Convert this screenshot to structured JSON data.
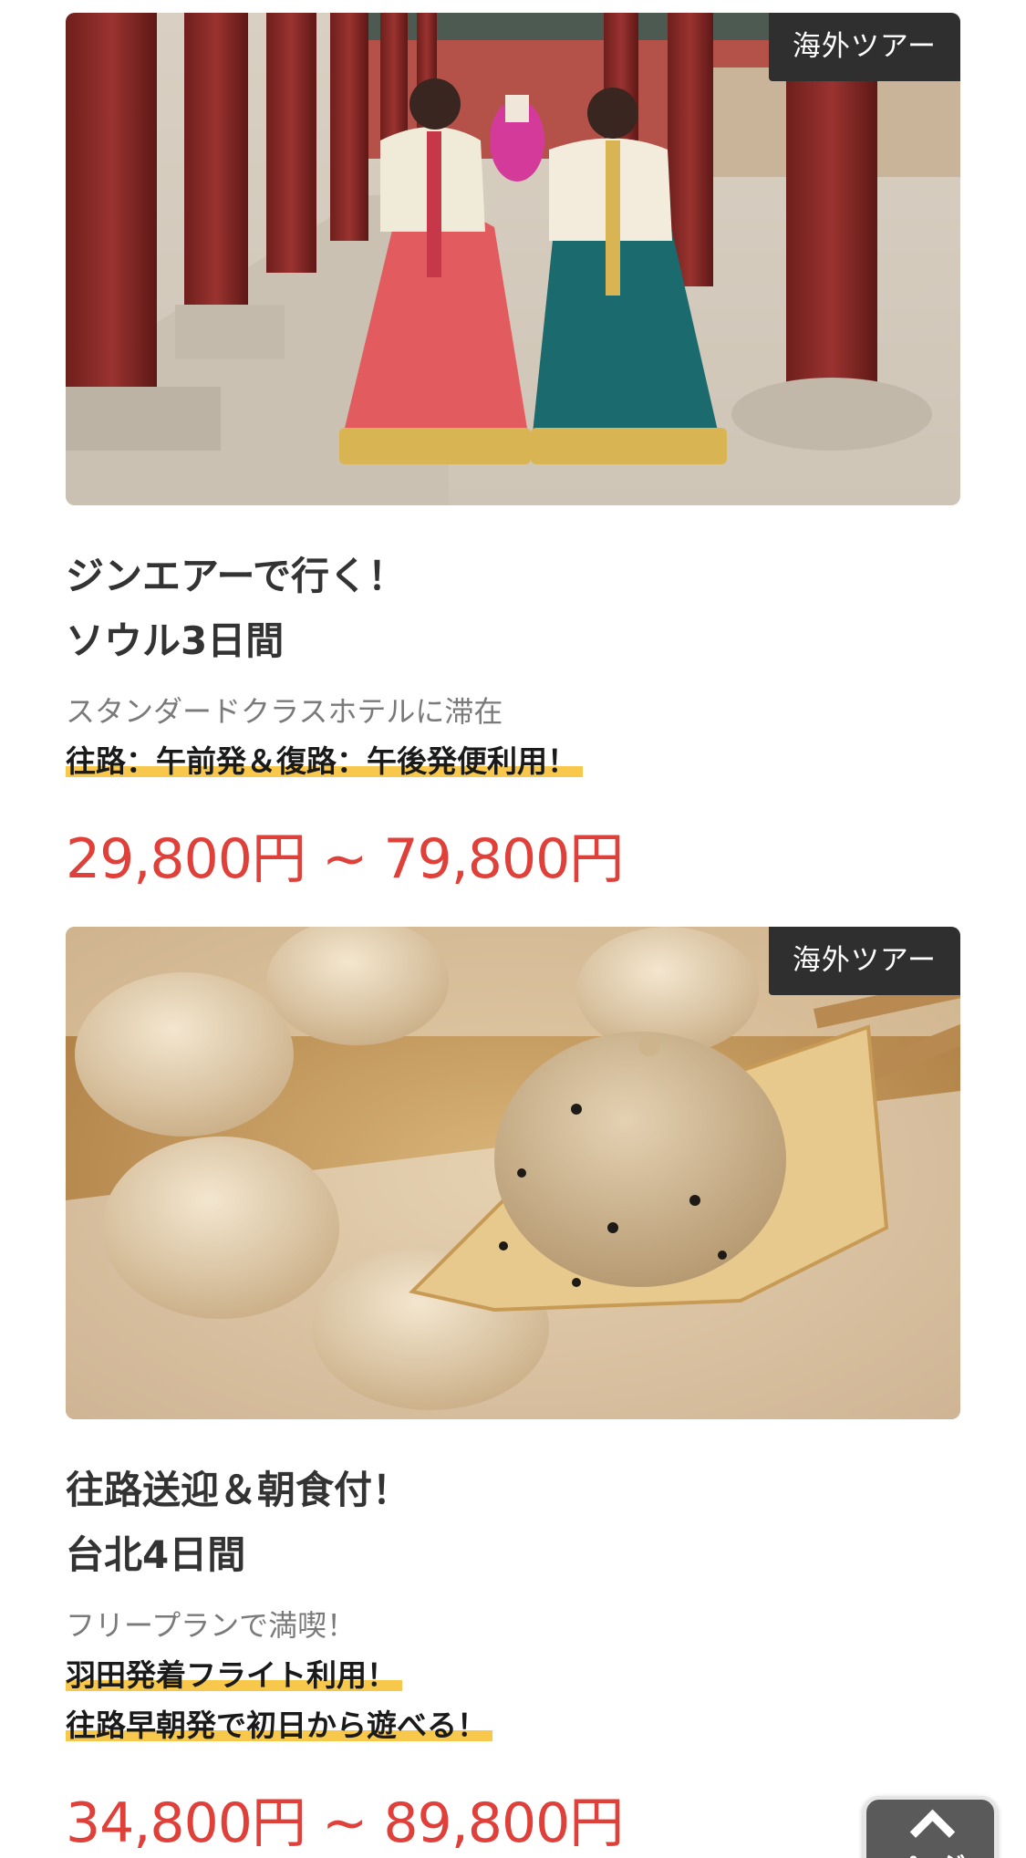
{
  "tours": [
    {
      "badge": "海外ツアー",
      "image": "seoul-hanbok-photo",
      "title_line1": "ジンエアーで行く！",
      "title_line2": "ソウル3日間",
      "subtitle": "スタンダードクラスホテルに滞在",
      "highlights": [
        "往路：午前発＆復路：午後発便利用！"
      ],
      "price": "29,800円 ~ 79,800円"
    },
    {
      "badge": "海外ツアー",
      "image": "taipei-dumpling-photo",
      "title_line1": "往路送迎＆朝食付！",
      "title_line2": "台北4日間",
      "subtitle": "フリープランで満喫！",
      "highlights": [
        "羽田発着フライト利用！",
        "往路早朝発で初日から遊べる！"
      ],
      "price": "34,800円 ~ 89,800円"
    }
  ],
  "page_top_button": {
    "icon": "chevron-up-icon",
    "label": "ページ"
  },
  "colors": {
    "price": "#e0403a",
    "highlight": "#f7c84b",
    "badge_bg": "#2f2f2f"
  }
}
